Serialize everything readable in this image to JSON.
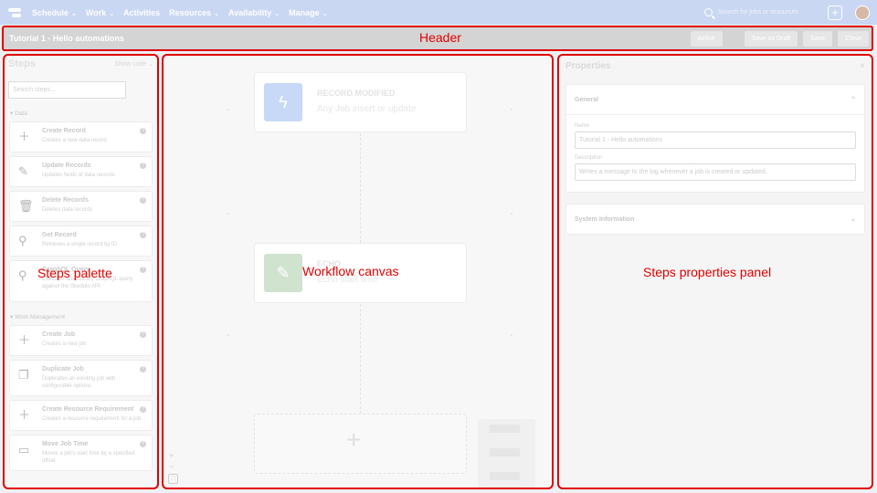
{
  "nav": {
    "items": [
      {
        "label": "Schedule",
        "chevron": true
      },
      {
        "label": "Work",
        "chevron": true
      },
      {
        "label": "Activities",
        "chevron": false
      },
      {
        "label": "Resources",
        "chevron": true
      },
      {
        "label": "Availability",
        "chevron": true
      },
      {
        "label": "Manage",
        "chevron": true
      }
    ],
    "search_placeholder": "Search for jobs or resources"
  },
  "header": {
    "workflow_title": "Tutorial 1 - Hello automations",
    "annotation": "Header",
    "buttons": {
      "active": "Active",
      "save_draft": "Save as Draft",
      "save": "Save",
      "close": "Close"
    }
  },
  "steps": {
    "title": "Steps",
    "show_code": "Show code",
    "search_placeholder": "Search steps...",
    "annotation": "Steps palette",
    "sections": {
      "data": "Data",
      "work": "Work Management"
    },
    "data_steps": [
      {
        "icon": "plus-icon",
        "name": "Create Record",
        "desc": "Creates a new data record"
      },
      {
        "icon": "pencil-icon",
        "name": "Update Records",
        "desc": "Updates fields of data records"
      },
      {
        "icon": "trash-icon",
        "name": "Delete Records",
        "desc": "Deletes data records"
      },
      {
        "icon": "search-icon",
        "name": "Get Record",
        "desc": "Retrieves a single record by ID"
      },
      {
        "icon": "search-icon",
        "name": "GraphQL Query",
        "desc": "Executes an arbitrary GraphQL query against the Skedulo API"
      }
    ],
    "work_steps": [
      {
        "icon": "plus-icon",
        "name": "Create Job",
        "desc": "Creates a new job"
      },
      {
        "icon": "copy-icon",
        "name": "Duplicate Job",
        "desc": "Duplicates an existing job with configurable options"
      },
      {
        "icon": "plus-icon",
        "name": "Create Resource Requirement",
        "desc": "Creates a resource requirement for a job"
      },
      {
        "icon": "calendar-icon",
        "name": "Move Job Time",
        "desc": "Moves a job's start time by a specified offset"
      }
    ],
    "help": "?"
  },
  "canvas": {
    "annotation": "Workflow canvas",
    "trigger": {
      "title": "RECORD MODIFIED",
      "subtitle": "Any Job insert or update",
      "color": "#c7d9f7"
    },
    "echo": {
      "title": "ECHO",
      "subtitle": "Echo start time",
      "color": "#cfe3cf"
    },
    "add_symbol": "+",
    "zoom_in": "+",
    "zoom_out": "−",
    "fit": "⛶"
  },
  "properties": {
    "title": "Properties",
    "close": "×",
    "annotation": "Steps properties panel",
    "general": {
      "heading": "General",
      "name_label": "Name",
      "name_value": "Tutorial 1 - Hello automations",
      "description_label": "Description",
      "description_value": "Writes a message to the log whenever a job is created or updated."
    },
    "system_heading": "System Information"
  }
}
